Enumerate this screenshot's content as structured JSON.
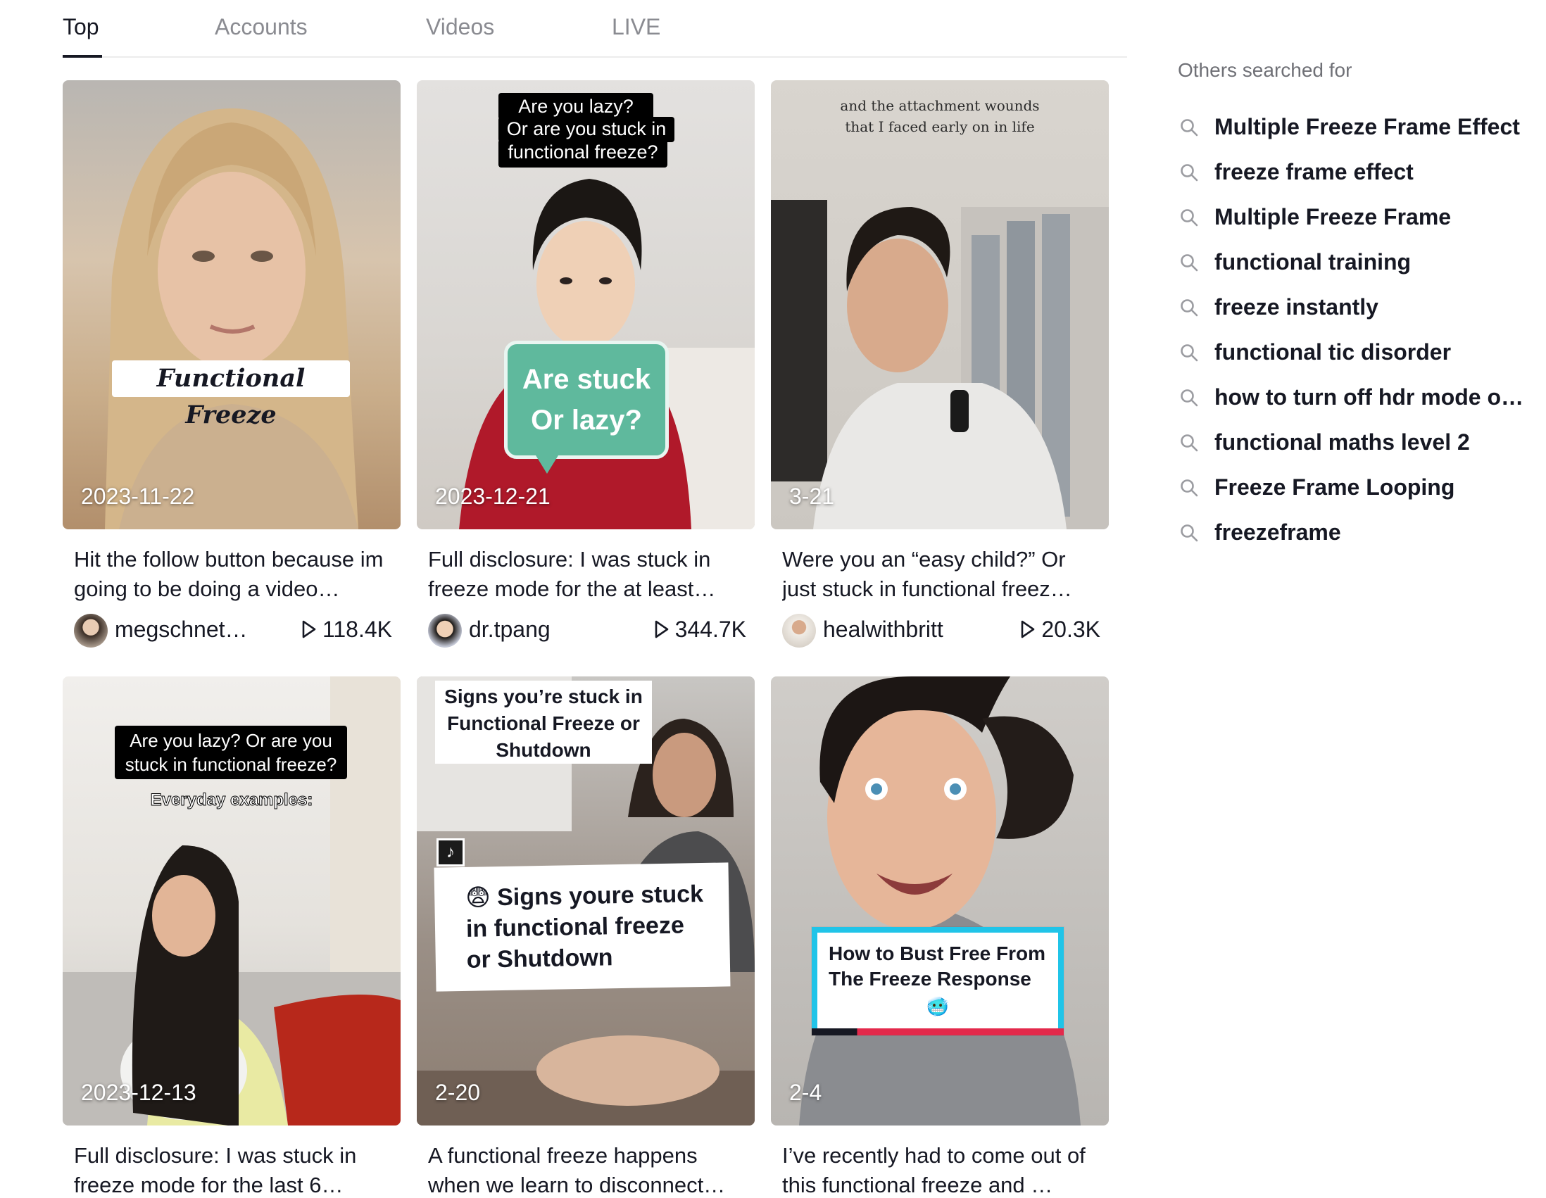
{
  "tabs": [
    {
      "label": "Top",
      "active": true
    },
    {
      "label": "Accounts",
      "active": false
    },
    {
      "label": "Videos",
      "active": false
    },
    {
      "label": "LIVE",
      "active": false
    }
  ],
  "videos": [
    {
      "date": "2023-11-22",
      "description": "Hit the follow button because im going to be doing a video…",
      "author": "megschnet…",
      "plays": "118.4K",
      "overlay": [
        "Functional Freeze"
      ]
    },
    {
      "date": "2023-12-21",
      "description": "Full disclosure: I was stuck in freeze mode for the at least…",
      "author": "dr.tpang",
      "plays": "344.7K",
      "overlay": [
        "Are you lazy?",
        "Or are you stuck in",
        "functional freeze?",
        "Are stuck",
        "Or lazy?"
      ]
    },
    {
      "date": "3-21",
      "description": "Were you an “easy child?” Or just stuck in functional freez…",
      "author": "healwithbritt",
      "plays": "20.3K",
      "overlay": [
        "and the attachment wounds",
        "that I faced early on in life"
      ]
    },
    {
      "date": "2023-12-13",
      "description": "Full disclosure: I was stuck in freeze mode for the last 6…",
      "author": "",
      "plays": "",
      "overlay": [
        "Are you lazy? Or are you",
        "stuck in functional freeze?",
        "Everyday examples:"
      ]
    },
    {
      "date": "2-20",
      "description": "A functional freeze happens when we learn to disconnect…",
      "author": "",
      "plays": "",
      "overlay": [
        "Signs you’re stuck in",
        "Functional Freeze or",
        "Shutdown",
        "😨 Signs youre stuck",
        "in functional freeze",
        "or Shutdown"
      ]
    },
    {
      "date": "2-4",
      "description": "I’ve recently had to come out of this functional freeze and …",
      "author": "",
      "plays": "",
      "overlay": [
        "How to Bust Free From",
        "The Freeze Response",
        "🥶"
      ]
    }
  ],
  "sidebar": {
    "title": "Others searched for",
    "suggestions": [
      "Multiple Freeze Frame Effect",
      "freeze frame effect",
      "Multiple Freeze Frame",
      "functional training",
      "freeze instantly",
      "functional tic disorder",
      "how to turn off hdr mode o…",
      "functional maths level 2",
      "Freeze Frame Looping",
      "freezeframe"
    ]
  },
  "icons": {
    "search": "search-icon",
    "play": "play-icon",
    "tiktok": "tiktok-logo-icon"
  }
}
